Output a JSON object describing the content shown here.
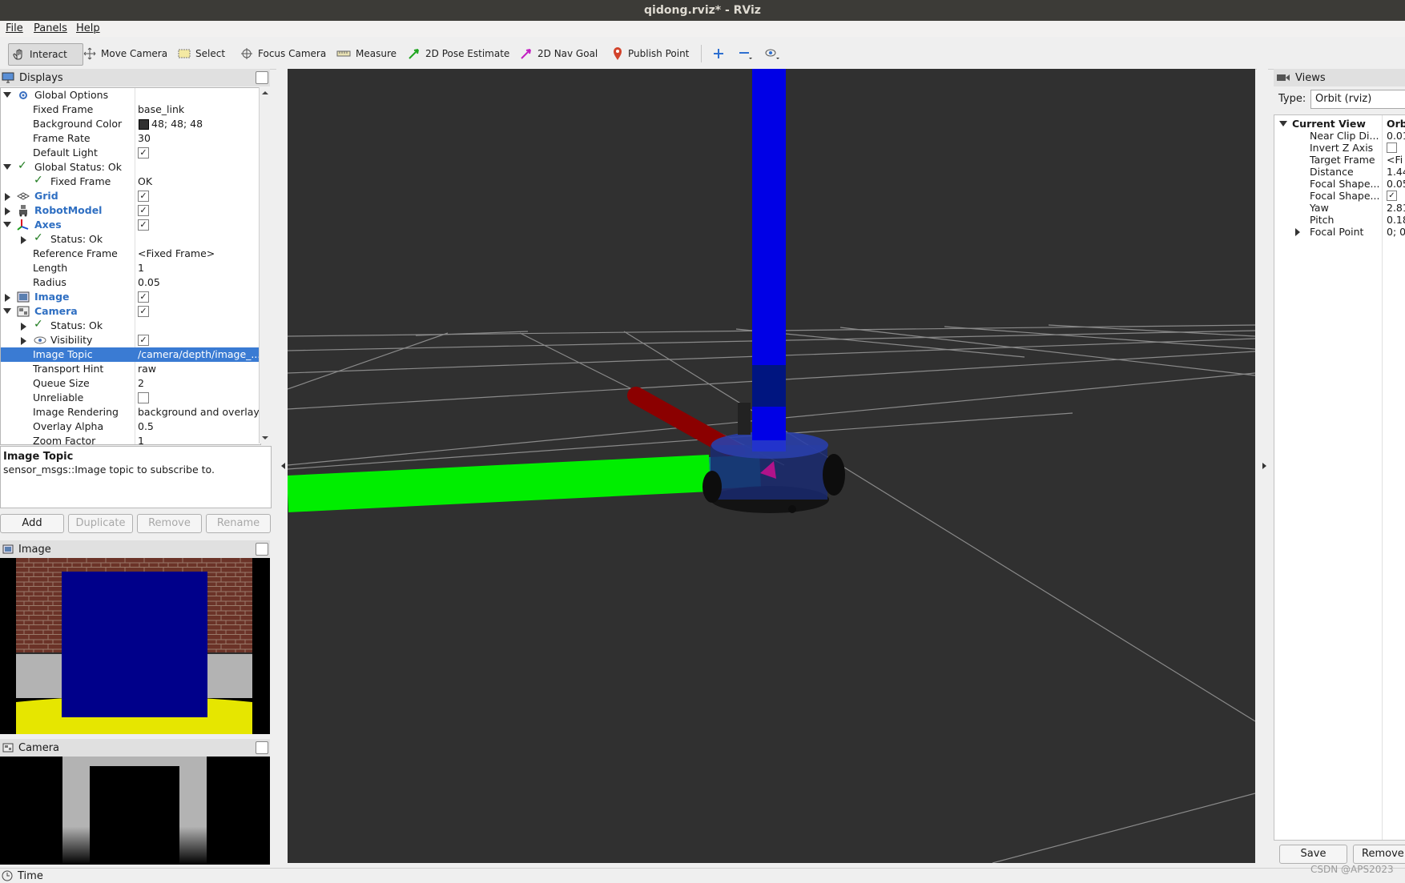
{
  "window": {
    "title": "qidong.rviz* - RViz"
  },
  "menu": {
    "file": "File",
    "panels": "Panels",
    "help": "Help"
  },
  "toolbar": {
    "interact": "Interact",
    "move_camera": "Move Camera",
    "select": "Select",
    "focus_camera": "Focus Camera",
    "measure": "Measure",
    "pose_estimate": "2D Pose Estimate",
    "nav_goal": "2D Nav Goal",
    "publish_point": "Publish Point"
  },
  "displays": {
    "title": "Displays",
    "rows": {
      "global_options": "Global Options",
      "fixed_frame": "Fixed Frame",
      "fixed_frame_val": "base_link",
      "bg_color": "Background Color",
      "bg_color_val": "48; 48; 48",
      "frame_rate": "Frame Rate",
      "frame_rate_val": "30",
      "default_light": "Default Light",
      "global_status": "Global Status: Ok",
      "gs_fixed_frame": "Fixed Frame",
      "gs_fixed_frame_val": "OK",
      "grid": "Grid",
      "robot_model": "RobotModel",
      "axes": "Axes",
      "axes_status": "Status: Ok",
      "reference_frame": "Reference Frame",
      "reference_frame_val": "<Fixed Frame>",
      "length": "Length",
      "length_val": "1",
      "radius": "Radius",
      "radius_val": "0.05",
      "image": "Image",
      "camera": "Camera",
      "camera_status": "Status: Ok",
      "visibility": "Visibility",
      "image_topic": "Image Topic",
      "image_topic_val": "/camera/depth/image_...",
      "transport_hint": "Transport Hint",
      "transport_hint_val": "raw",
      "queue_size": "Queue Size",
      "queue_size_val": "2",
      "unreliable": "Unreliable",
      "image_rendering": "Image Rendering",
      "image_rendering_val": "background and overlay",
      "overlay_alpha": "Overlay Alpha",
      "overlay_alpha_val": "0.5",
      "zoom_factor": "Zoom Factor",
      "zoom_factor_val": "1"
    },
    "description": {
      "title": "Image Topic",
      "text": "sensor_msgs::Image topic to subscribe to."
    },
    "buttons": {
      "add": "Add",
      "duplicate": "Duplicate",
      "remove": "Remove",
      "rename": "Rename"
    }
  },
  "image_panel": {
    "title": "Image"
  },
  "camera_panel": {
    "title": "Camera"
  },
  "views": {
    "title": "Views",
    "type_label": "Type:",
    "type_value": "Orbit (rviz)",
    "current_view": "Current View",
    "current_view_val": "Orb",
    "rows": [
      {
        "name": "Near Clip Di...",
        "val": "0.01"
      },
      {
        "name": "Invert Z Axis",
        "val": ""
      },
      {
        "name": "Target Frame",
        "val": "<Fi"
      },
      {
        "name": "Distance",
        "val": "1.44"
      },
      {
        "name": "Focal Shape...",
        "val": "0.05"
      },
      {
        "name": "Focal Shape...",
        "val": ""
      },
      {
        "name": "Yaw",
        "val": "2.81"
      },
      {
        "name": "Pitch",
        "val": "0.18"
      },
      {
        "name": "Focal Point",
        "val": "0; 0"
      }
    ],
    "save": "Save",
    "remove": "Remove"
  },
  "status": {
    "time": "Time"
  },
  "watermark": "CSDN @APS2023"
}
